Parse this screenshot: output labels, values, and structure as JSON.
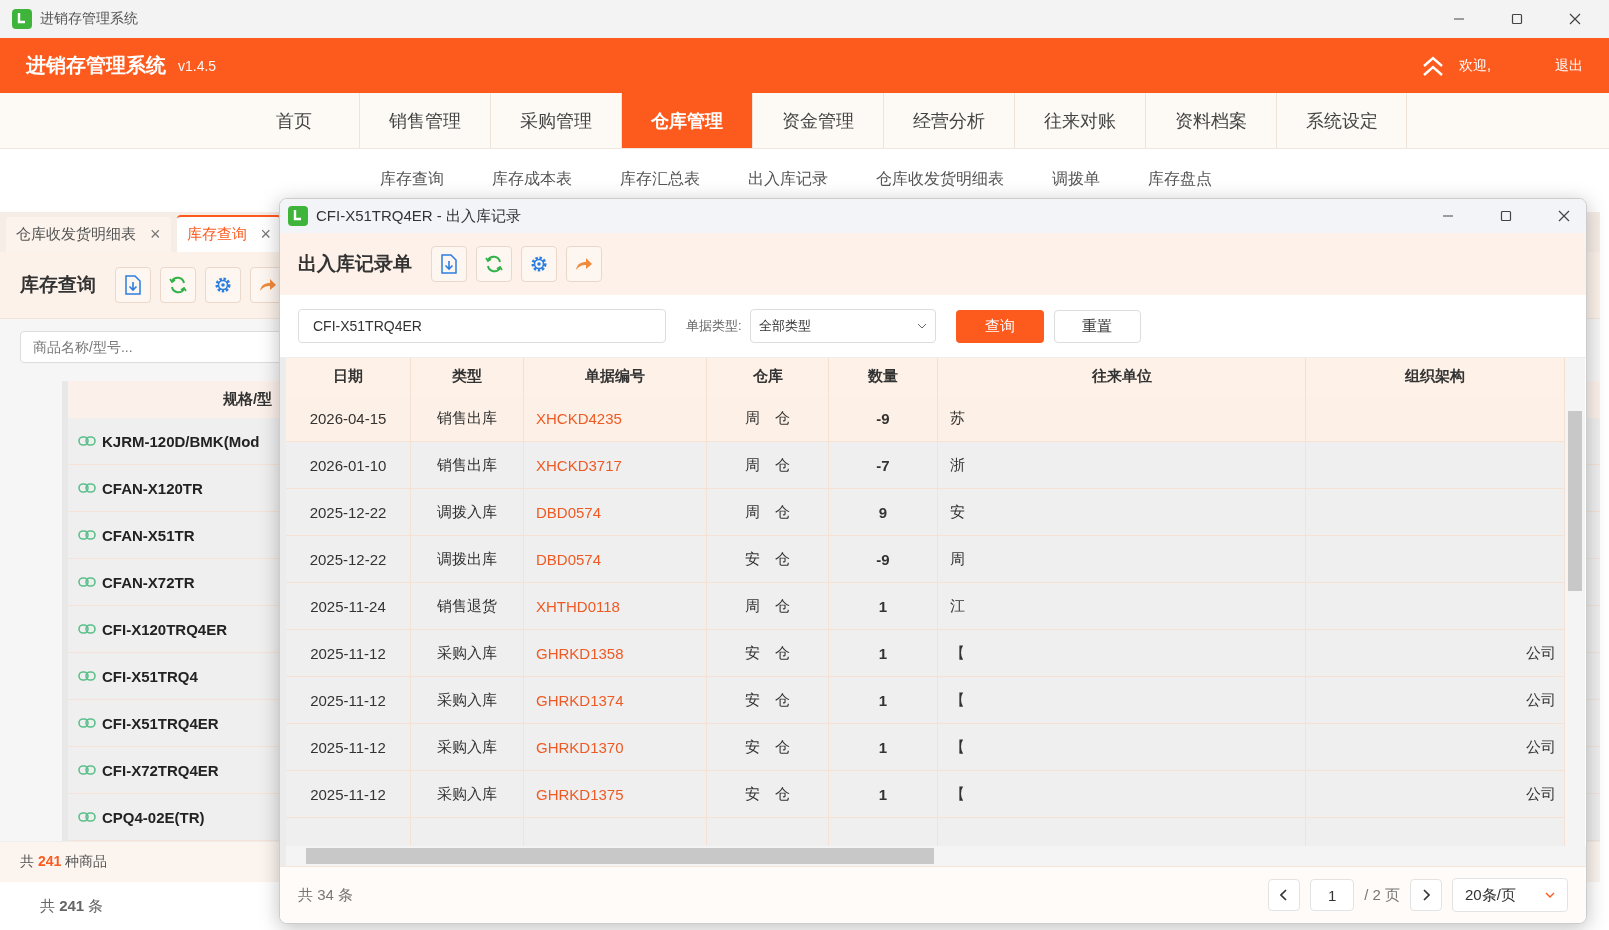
{
  "window": {
    "title": "进销存管理系统"
  },
  "header": {
    "app_name": "进销存管理系统",
    "version": "v1.4.5",
    "welcome": "欢迎,",
    "logout": "退出"
  },
  "nav": [
    {
      "label": "首页",
      "selected": false
    },
    {
      "label": "销售管理",
      "selected": false
    },
    {
      "label": "采购管理",
      "selected": false
    },
    {
      "label": "仓库管理",
      "selected": true
    },
    {
      "label": "资金管理",
      "selected": false
    },
    {
      "label": "经营分析",
      "selected": false
    },
    {
      "label": "往来对账",
      "selected": false
    },
    {
      "label": "资料档案",
      "selected": false
    },
    {
      "label": "系统设定",
      "selected": false
    }
  ],
  "subnav": [
    "库存查询",
    "库存成本表",
    "库存汇总表",
    "出入库记录",
    "仓库收发货明细表",
    "调拨单",
    "库存盘点"
  ],
  "doc_tabs": [
    {
      "label": "仓库收发货明细表",
      "close": "×",
      "selected": false
    },
    {
      "label": "库存查询",
      "close": "×",
      "selected": true
    }
  ],
  "inventory": {
    "title": "库存查询",
    "search_placeholder": "商品名称/型号...",
    "column": "规格/型",
    "rows": [
      "KJRM-120D/BMK(Mod",
      "CFAN-X120TR",
      "CFAN-X51TR",
      "CFAN-X72TR",
      "CFI-X120TRQ4ER",
      "CFI-X51TRQ4",
      "CFI-X51TRQ4ER",
      "CFI-X72TRQ4ER",
      "CPQ4-02E(TR)"
    ],
    "summary": "共 **241** 种商品",
    "total": "共 **241** 条"
  },
  "dialog": {
    "title": "CFI-X51TRQ4ER - 出入库记录",
    "heading": "出入库记录单",
    "search_value": "CFI-X51TRQ4ER",
    "type_label": "单据类型:",
    "type_value": "全部类型",
    "query_button": "查询",
    "reset_button": "重置",
    "columns": [
      "日期",
      "类型",
      "单据编号",
      "仓库",
      "数量",
      "往来单位",
      "组织架构"
    ],
    "rows": [
      {
        "date": "2026-04-15",
        "type": "销售出库",
        "number": "XHCKD4235",
        "warehouse": "周　仓",
        "qty": "-9",
        "partner": "苏",
        "org": "",
        "selected": true
      },
      {
        "date": "2026-01-10",
        "type": "销售出库",
        "number": "XHCKD3717",
        "warehouse": "周　仓",
        "qty": "-7",
        "partner": "浙",
        "org": "",
        "selected": false
      },
      {
        "date": "2025-12-22",
        "type": "调拨入库",
        "number": "DBD0574",
        "warehouse": "周　仓",
        "qty": "9",
        "partner": "安",
        "org": "",
        "selected": false
      },
      {
        "date": "2025-12-22",
        "type": "调拨出库",
        "number": "DBD0574",
        "warehouse": "安　仓",
        "qty": "-9",
        "partner": "周",
        "org": "",
        "selected": false
      },
      {
        "date": "2025-11-24",
        "type": "销售退货",
        "number": "XHTHD0118",
        "warehouse": "周　仓",
        "qty": "1",
        "partner": "江",
        "org": "",
        "selected": false
      },
      {
        "date": "2025-11-12",
        "type": "采购入库",
        "number": "GHRKD1358",
        "warehouse": "安　仓",
        "qty": "1",
        "partner": "【",
        "org": "公司",
        "selected": false
      },
      {
        "date": "2025-11-12",
        "type": "采购入库",
        "number": "GHRKD1374",
        "warehouse": "安　仓",
        "qty": "1",
        "partner": "【",
        "org": "公司",
        "selected": false
      },
      {
        "date": "2025-11-12",
        "type": "采购入库",
        "number": "GHRKD1370",
        "warehouse": "安　仓",
        "qty": "1",
        "partner": "【",
        "org": "公司",
        "selected": false
      },
      {
        "date": "2025-11-12",
        "type": "采购入库",
        "number": "GHRKD1375",
        "warehouse": "安　仓",
        "qty": "1",
        "partner": "【",
        "org": "公司",
        "selected": false
      }
    ],
    "total": "共 34 条",
    "page": "1",
    "pages": "/ 2 页",
    "page_size": "20条/页"
  }
}
